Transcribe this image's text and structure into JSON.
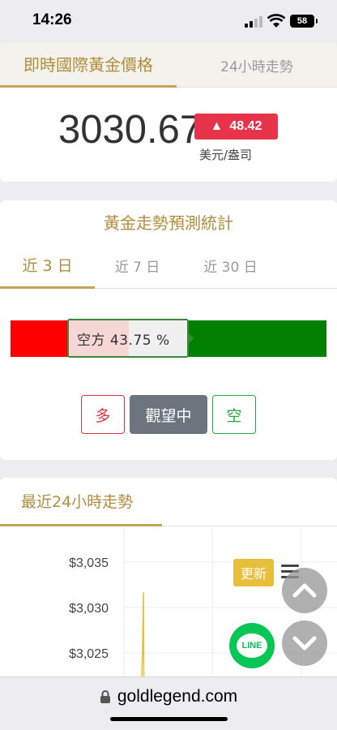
{
  "status_bar": {
    "time": "14:26",
    "battery": "58"
  },
  "price_tabs": {
    "active": "即時國際黃金價格",
    "other": "24小時走勢"
  },
  "price": {
    "value": "3030.67",
    "change": "48.42",
    "change_arrow": "▲",
    "unit": "美元/盎司",
    "change_color": "#e8344a"
  },
  "forecast": {
    "title": "黃金走勢預測統計",
    "periods": [
      "近 3 日",
      "近 7 日",
      "近 30 日"
    ],
    "active_period": "近 3 日",
    "short_ratio": 0.1825,
    "tooltip": "空方 43.75 %",
    "buttons": {
      "long": "多",
      "wait": "觀望中",
      "short": "空"
    }
  },
  "trend": {
    "title": "最近24小時走勢",
    "update_label": "更新",
    "y_ticks": [
      "$3,035",
      "$3,030",
      "$3,025"
    ]
  },
  "browser": {
    "url": "goldlegend.com"
  },
  "floating": {
    "line_label": "LINE"
  }
}
